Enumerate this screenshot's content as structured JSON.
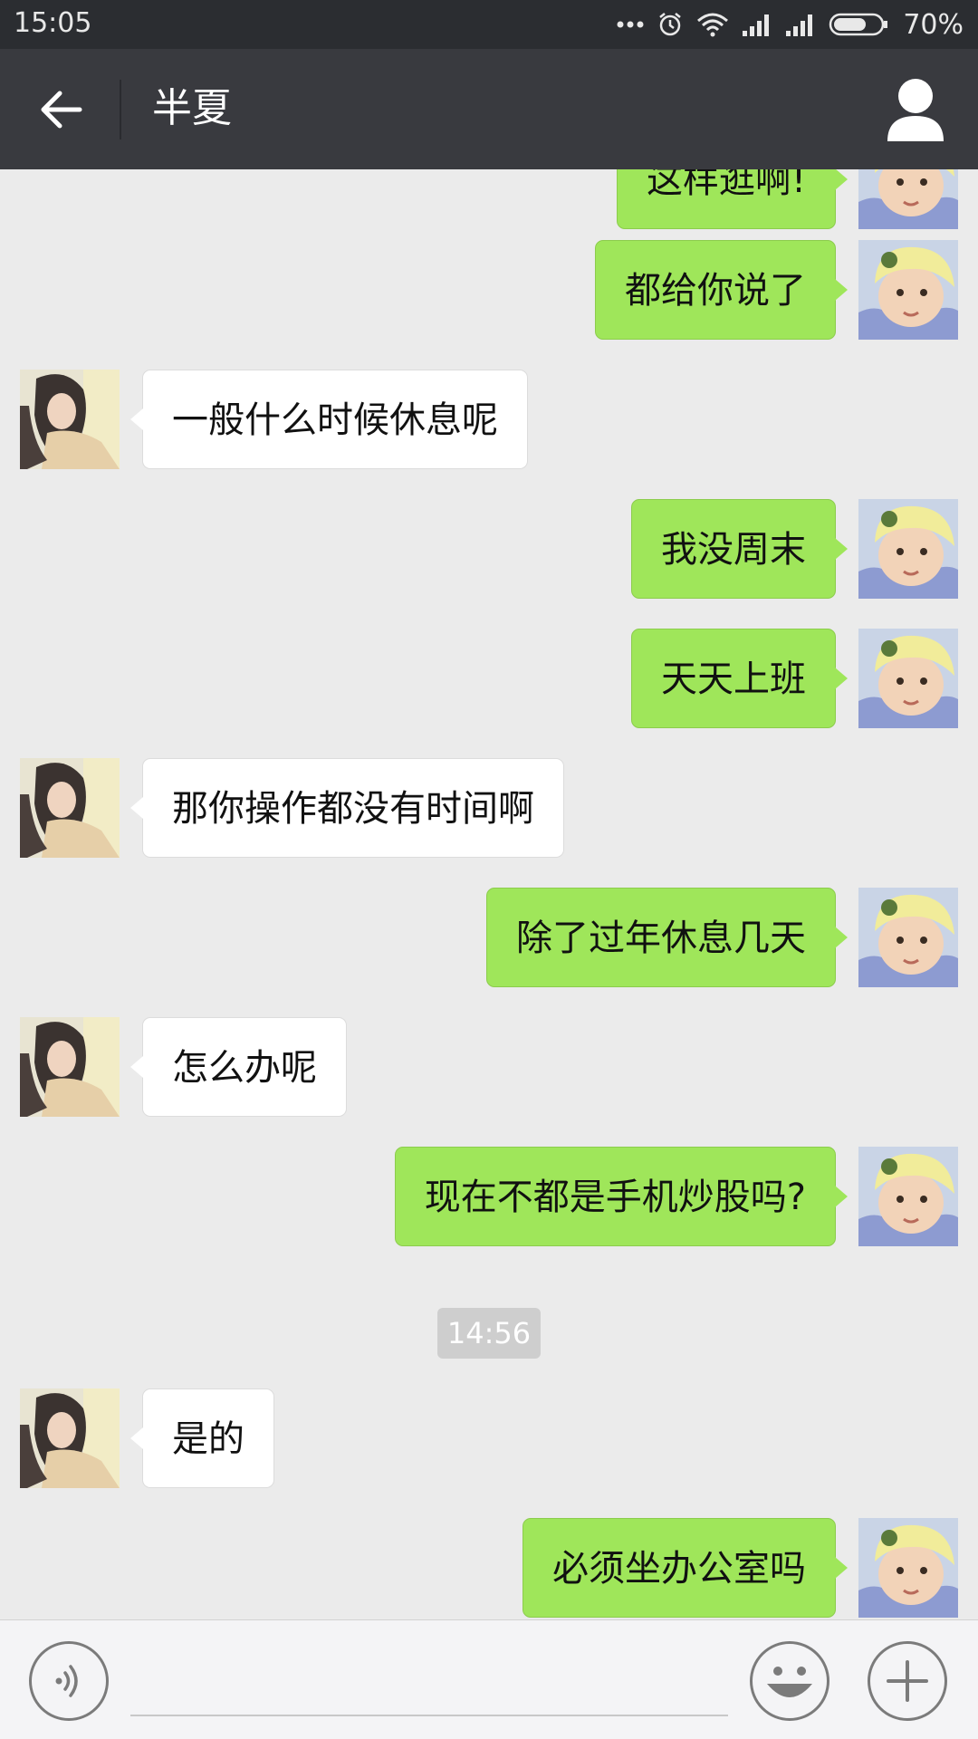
{
  "status_bar": {
    "time": "15:05",
    "icons": [
      "more-dots-icon",
      "alarm-icon",
      "wifi-icon",
      "signal-icon",
      "signal-icon",
      "battery-icon"
    ],
    "battery_level": 0.7,
    "battery_text": "70%"
  },
  "header": {
    "title": "半夏",
    "back_icon": "back-arrow-icon",
    "profile_icon": "person-icon"
  },
  "messages": [
    {
      "side": "me",
      "text": "这样逛啊!"
    },
    {
      "side": "me",
      "text": "都给你说了"
    },
    {
      "side": "them",
      "text": "一般什么时候休息呢"
    },
    {
      "side": "me",
      "text": "我没周末"
    },
    {
      "side": "me",
      "text": "天天上班"
    },
    {
      "side": "them",
      "text": "那你操作都没有时间啊"
    },
    {
      "side": "me",
      "text": "除了过年休息几天"
    },
    {
      "side": "them",
      "text": "怎么办呢"
    },
    {
      "side": "me",
      "text": "现在不都是手机炒股吗?"
    },
    {
      "side": "them",
      "text": "是的"
    },
    {
      "side": "me",
      "text": "必须坐办公室吗"
    }
  ],
  "timestamp": "14:56",
  "input_bar": {
    "placeholder": "",
    "voice_icon": "voice-icon",
    "emoji_icon": "emoji-icon",
    "plus_icon": "plus-icon"
  },
  "colors": {
    "my_bubble": "#9fe65a",
    "their_bubble": "#ffffff",
    "header": "#393a3f",
    "status_bar": "#2b2d31",
    "background": "#ebebeb"
  }
}
